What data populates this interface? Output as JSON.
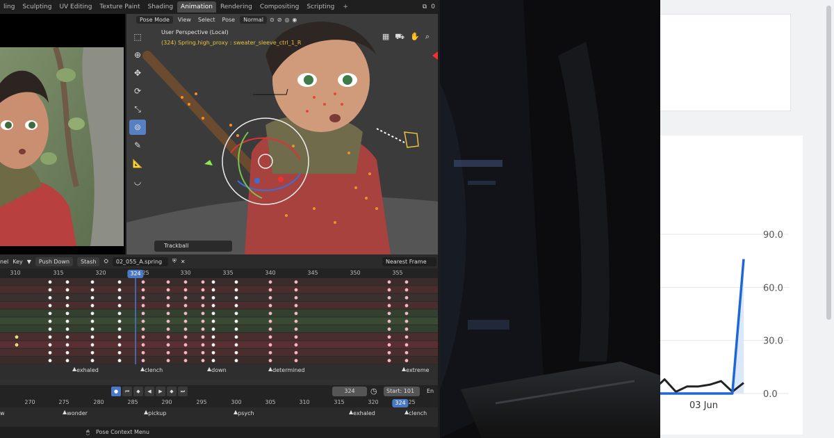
{
  "blender": {
    "workspace_tabs": [
      "ling",
      "Sculpting",
      "UV Editing",
      "Texture Paint",
      "Shading",
      "Animation",
      "Rendering",
      "Compositing",
      "Scripting"
    ],
    "active_tab": "Animation",
    "add_tab": "+",
    "top_right_text": "0",
    "viewport": {
      "mode": "Pose Mode",
      "menus": [
        "View",
        "Select",
        "Pose"
      ],
      "orientation": "Normal",
      "perspective": "User Perspective (Local)",
      "active_info": "(324) Spring.high_proxy : sweater_sleeve_ctrl_1_R",
      "operator_panel": "Trackball"
    },
    "dopesheet": {
      "mode_trunc": "nel",
      "key_menu": "Key",
      "push_down": "Push Down",
      "stash": "Stash",
      "action_name": "02_055_A.spring",
      "snap_mode": "Nearest Frame",
      "ruler_ticks": [
        "310",
        "315",
        "320",
        "325",
        "330",
        "335",
        "340",
        "345",
        "350",
        "355"
      ],
      "current_frame_badge": "324",
      "markers": [
        "exhaled",
        "clench",
        "down",
        "determined",
        "extreme"
      ]
    },
    "timeline": {
      "current_frame": "324",
      "start_label": "Start:",
      "start_value": "101",
      "end_trunc": "En",
      "ruler_ticks": [
        "270",
        "275",
        "280",
        "285",
        "290",
        "295",
        "300",
        "305",
        "310",
        "315",
        "320",
        "325"
      ],
      "current_frame_badge": "324",
      "markers": [
        "w",
        "wonder",
        "pickup",
        "psych",
        "exhaled",
        "clench"
      ]
    },
    "status": {
      "context_menu": "Pose Context Menu"
    }
  },
  "dashboard": {
    "chart_data": {
      "type": "line",
      "title": "",
      "xlabel": "",
      "ylabel": "",
      "x_tick_labels": [
        "03 Jun"
      ],
      "y_tick_labels": [
        "90.0",
        "60.0",
        "30.0",
        "0.0"
      ],
      "ylim": [
        0,
        90
      ],
      "series": [
        {
          "color": "#222222",
          "values": [
            2,
            8,
            1,
            4,
            4,
            5,
            7,
            1,
            6
          ]
        },
        {
          "color": "#1f66d6",
          "values": [
            0,
            0,
            0,
            0,
            0,
            0,
            0,
            0,
            76
          ]
        }
      ],
      "grid": true
    }
  }
}
